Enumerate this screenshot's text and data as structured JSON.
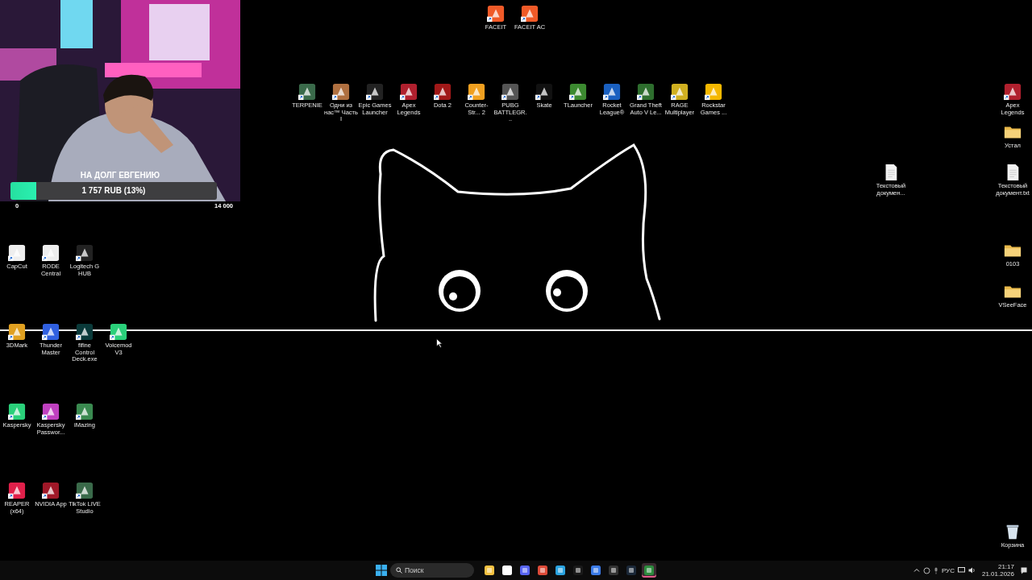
{
  "stream_overlay": {
    "donation_goal": {
      "title": "НА ДОЛГ ЕВГЕНИЮ",
      "amount": "1 757 RUB (13%)",
      "level": 0.125,
      "min": "0",
      "max": "14 000"
    }
  },
  "top_icons": [
    {
      "label": "FACEIT",
      "kind": "shortcut"
    },
    {
      "label": "FACEIT AC",
      "kind": "shortcut"
    }
  ],
  "game_icons": [
    {
      "label": "TERPENIE",
      "kind": "shortcut"
    },
    {
      "label": "Одни из нас™ Часть I",
      "kind": "shortcut"
    },
    {
      "label": "Epic Games Launcher",
      "kind": "shortcut"
    },
    {
      "label": "Apex Legends",
      "kind": "shortcut"
    },
    {
      "label": "Dota 2",
      "kind": "shortcut"
    },
    {
      "label": "Counter-Str... 2",
      "kind": "shortcut"
    },
    {
      "label": "PUBG BATTLEGR...",
      "kind": "shortcut"
    },
    {
      "label": "Skate",
      "kind": "shortcut"
    },
    {
      "label": "TLauncher",
      "kind": "shortcut"
    },
    {
      "label": "Rocket League®",
      "kind": "shortcut"
    },
    {
      "label": "Grand Theft Auto V Le...",
      "kind": "shortcut"
    },
    {
      "label": "RAGE Multiplayer",
      "kind": "shortcut"
    },
    {
      "label": "Rockstar Games ...",
      "kind": "shortcut"
    }
  ],
  "left_groups": [
    {
      "icons": [
        {
          "label": "CapCut",
          "kind": "shortcut"
        },
        {
          "label": "RODE Central",
          "kind": "shortcut"
        },
        {
          "label": "Logitech G HUB",
          "kind": "shortcut"
        }
      ]
    },
    {
      "icons": [
        {
          "label": "3DMark",
          "kind": "shortcut"
        },
        {
          "label": "Thunder Master",
          "kind": "shortcut"
        },
        {
          "label": "fifine Control Deck.exe",
          "kind": "shortcut"
        },
        {
          "label": "Voicemod V3",
          "kind": "shortcut"
        }
      ]
    },
    {
      "icons": [
        {
          "label": "Kaspersky",
          "kind": "shortcut"
        },
        {
          "label": "Kaspersky Passwor...",
          "kind": "shortcut"
        },
        {
          "label": "iMazing",
          "kind": "shortcut"
        }
      ]
    },
    {
      "icons": [
        {
          "label": "REAPER (x64)",
          "kind": "shortcut"
        },
        {
          "label": "NVIDIA App",
          "kind": "shortcut"
        },
        {
          "label": "TikTok LIVE Studio",
          "kind": "shortcut"
        }
      ]
    }
  ],
  "middle_icons": [
    {
      "label": "Текстовый докумен...",
      "kind": "document"
    }
  ],
  "right_icons": [
    {
      "label": "Apex Legends",
      "kind": "shortcut"
    },
    {
      "label": "Устал",
      "kind": "folder"
    },
    {
      "label": "Текстовый документ.txt",
      "kind": "document"
    },
    {
      "label": "0103",
      "kind": "folder"
    },
    {
      "label": "VSeeFace",
      "kind": "folder"
    },
    {
      "label": "Корзина",
      "kind": "recycle-bin"
    }
  ],
  "taskbar": {
    "search": {
      "placeholder": "Поиск"
    },
    "apps": [
      {
        "selected": false
      },
      {
        "selected": false
      },
      {
        "selected": false
      },
      {
        "selected": false
      },
      {
        "selected": false
      },
      {
        "selected": false
      },
      {
        "selected": false
      },
      {
        "selected": false
      },
      {
        "selected": false
      },
      {
        "selected": true
      }
    ],
    "tray": {
      "language": "РУС",
      "time": "21:17",
      "date": "21.01.2026"
    }
  }
}
